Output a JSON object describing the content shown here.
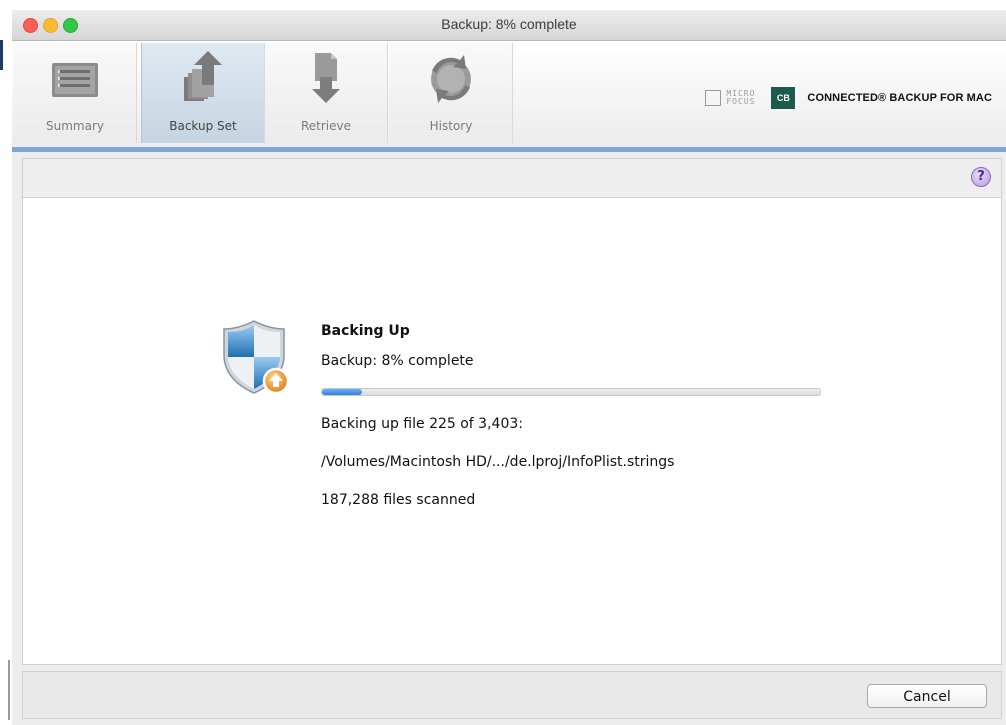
{
  "window": {
    "title": "Backup: 8% complete"
  },
  "toolbar": {
    "tabs": [
      {
        "label": "Summary",
        "icon": "summary-list-icon"
      },
      {
        "label": "Backup Set",
        "icon": "backup-set-upload-icon",
        "active": true
      },
      {
        "label": "Retrieve",
        "icon": "retrieve-download-icon"
      },
      {
        "label": "History",
        "icon": "history-clock-icon"
      }
    ],
    "brand": {
      "vendor_line1": "MICRO",
      "vendor_line2": "FOCUS",
      "badge": "CB",
      "product": "CONNECTED® BACKUP FOR MAC"
    }
  },
  "panel": {
    "help_label": "?",
    "status_title": "Backing Up",
    "status_line": "Backup: 8% complete",
    "progress_percent": 8,
    "file_line": "Backing up file 225 of 3,403:",
    "path_line": "/Volumes/Macintosh HD/.../de.lproj/InfoPlist.strings",
    "scanned_line": "187,288 files scanned"
  },
  "footer": {
    "cancel_label": "Cancel"
  },
  "colors": {
    "accent_bar": "#7fa8cf",
    "progress_fill": "#2e7fdf",
    "badge_green": "#1d5a4e"
  }
}
